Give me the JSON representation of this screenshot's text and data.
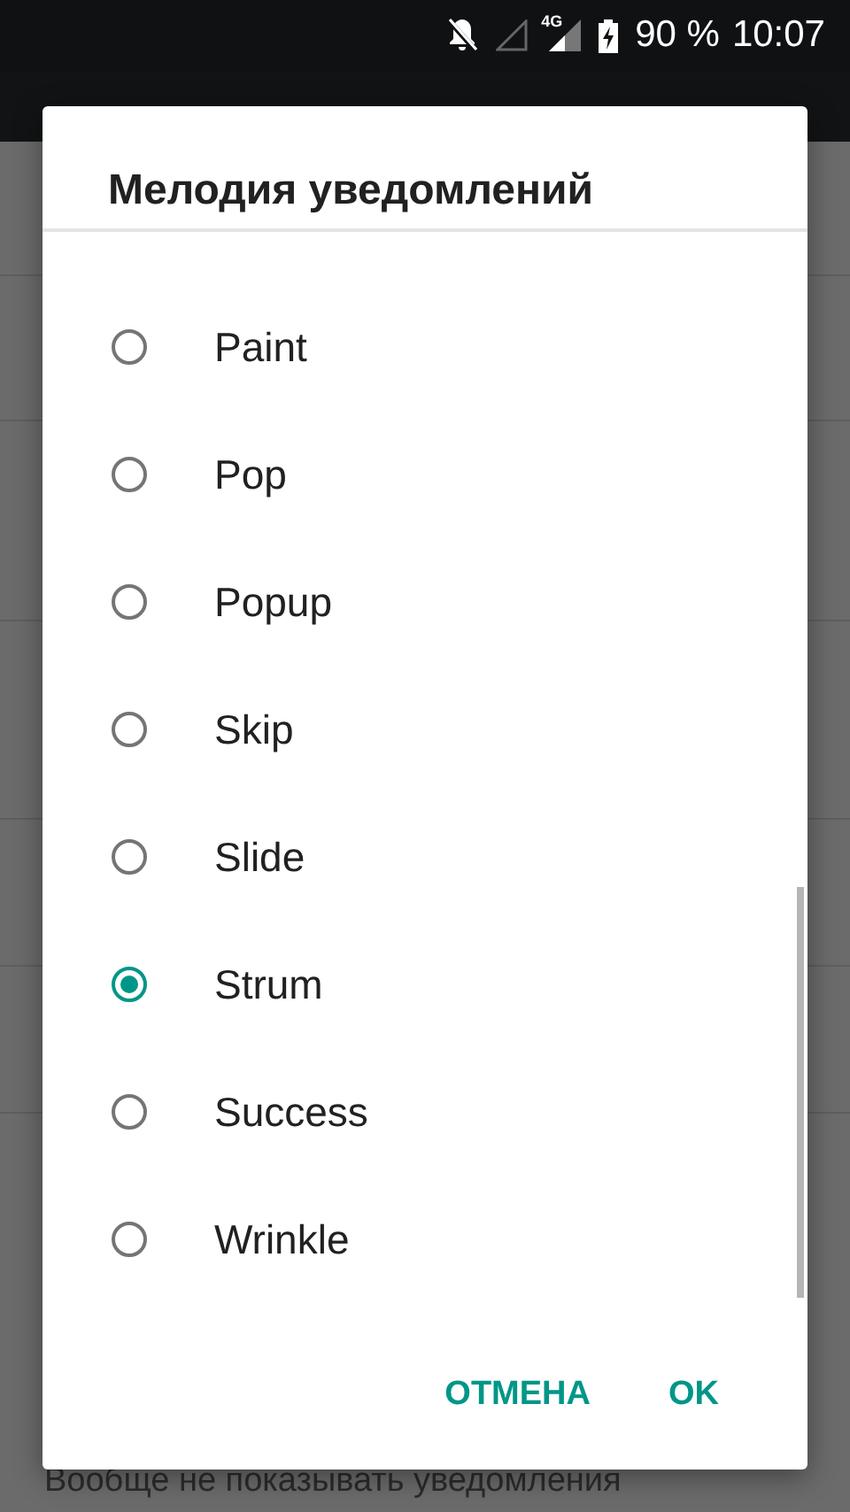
{
  "status_bar": {
    "network": "4G",
    "battery": "90 %",
    "time": "10:07"
  },
  "background": {
    "hint": "Вообще не показывать уведомления"
  },
  "dialog": {
    "title": "Мелодия уведомлений",
    "options": [
      {
        "label": "Paint",
        "selected": false
      },
      {
        "label": "Pop",
        "selected": false
      },
      {
        "label": "Popup",
        "selected": false
      },
      {
        "label": "Skip",
        "selected": false
      },
      {
        "label": "Slide",
        "selected": false
      },
      {
        "label": "Strum",
        "selected": true
      },
      {
        "label": "Success",
        "selected": false
      },
      {
        "label": "Wrinkle",
        "selected": false
      }
    ],
    "buttons": [
      "ОТМЕНА",
      "OK"
    ]
  }
}
